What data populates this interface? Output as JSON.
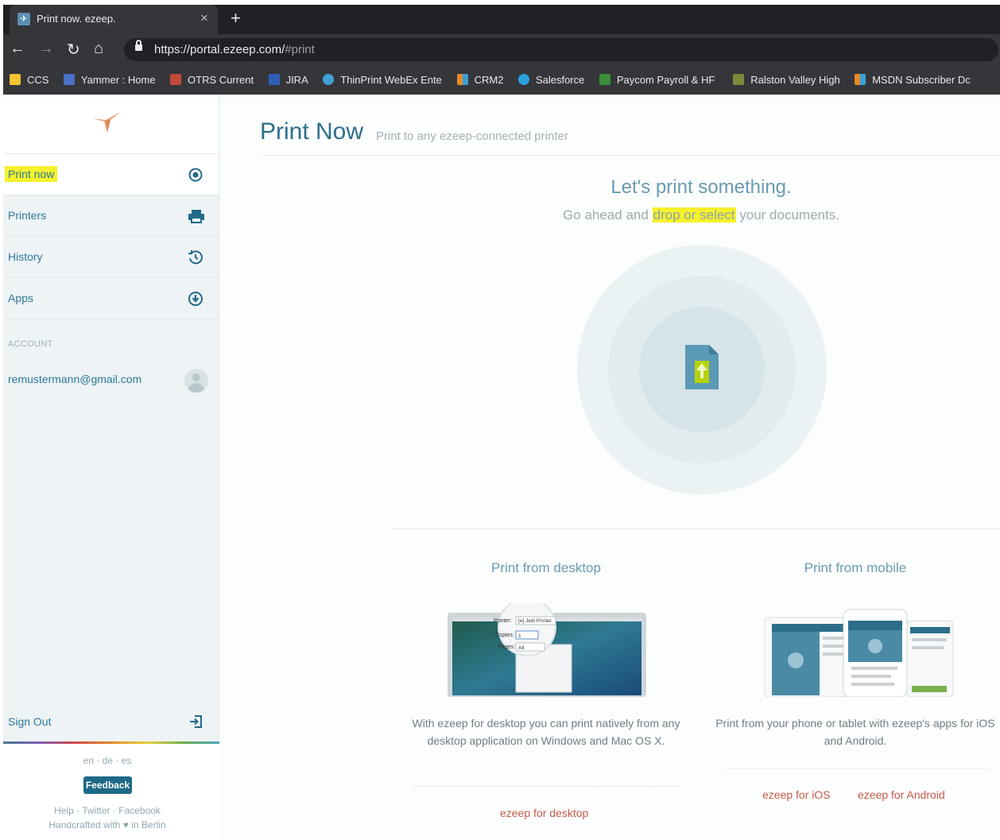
{
  "browser": {
    "tab_title": "Print now. ezeep.",
    "tab_close": "×",
    "new_tab": "+",
    "url_base": "https://portal.ezeep.com/",
    "url_hash": "#print",
    "bookmarks": [
      {
        "label": "CCS",
        "color": "#f2c230"
      },
      {
        "label": "Yammer : Home",
        "color": "#4a6fc9"
      },
      {
        "label": "OTRS Current",
        "color": "#c04a3a"
      },
      {
        "label": "JIRA",
        "color": "#2d5fb8"
      },
      {
        "label": "ThinPrint WebEx Ente",
        "color": "#3fa0d8"
      },
      {
        "label": "CRM2",
        "color": "#e58a2a"
      },
      {
        "label": "Salesforce",
        "color": "#2aa1de"
      },
      {
        "label": "Paycom Payroll & HF",
        "color": "#3b8f3b"
      },
      {
        "label": "Ralston Valley High",
        "color": "#7b8a3a"
      },
      {
        "label": "MSDN Subscriber Dc",
        "color": "#e58a2a"
      }
    ]
  },
  "sidebar": {
    "items": [
      {
        "label": "Print now",
        "icon": "target-icon"
      },
      {
        "label": "Printers",
        "icon": "printer-icon"
      },
      {
        "label": "History",
        "icon": "history-icon"
      },
      {
        "label": "Apps",
        "icon": "download-icon"
      }
    ],
    "account_heading": "ACCOUNT",
    "account_email": "remustermann@gmail.com",
    "sign_out": "Sign Out",
    "languages": "en · de · es",
    "feedback": "Feedback",
    "social": "Help · Twitter · Facebook",
    "crafted": "Handcrafted with ♥ in Berlin"
  },
  "main": {
    "title": "Print Now",
    "subtitle": "Print to any ezeep-connected printer",
    "headline": "Let's print something.",
    "subline_before": "Go ahead and ",
    "subline_highlight": "drop or select",
    "subline_after": " your documents.",
    "desktop": {
      "title": "Print from desktop",
      "description": "With ezeep for desktop you can print natively from any desktop application on Windows and Mac OS X.",
      "link": "ezeep for desktop",
      "dialog_printer_label": "Printer:",
      "dialog_printer_value": "[e] Jedi Printer",
      "dialog_copies_label": "Copies:",
      "dialog_copies_value": "1",
      "dialog_pages_label": "Pages:",
      "dialog_pages_value": "All"
    },
    "mobile": {
      "title": "Print from mobile",
      "description": "Print from your phone or tablet with ezeep's apps for iOS and Android.",
      "link_ios": "ezeep for iOS",
      "link_android": "ezeep for Android"
    }
  },
  "colors": {
    "accent": "#2a6f8d",
    "link_red": "#c55a4a",
    "highlight": "#f6f12b",
    "file_icon": "#5a9ab5",
    "upload_arrow": "#b8d20a"
  }
}
